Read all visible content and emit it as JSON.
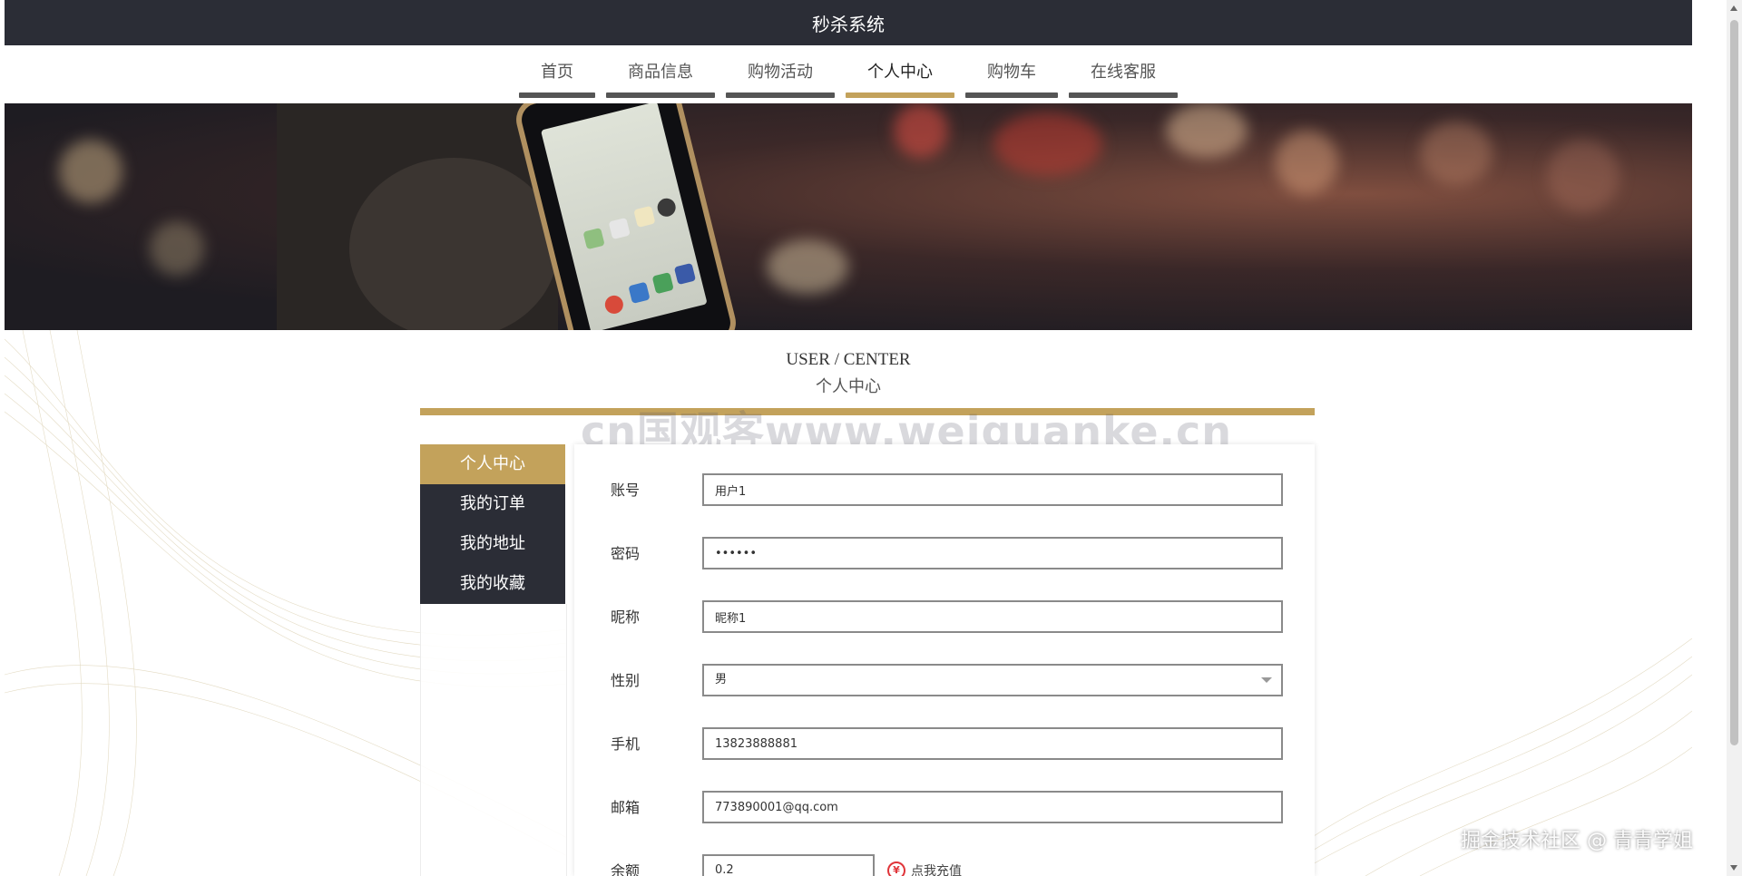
{
  "header": {
    "title": "秒杀系统"
  },
  "nav": {
    "items": [
      {
        "label": "首页"
      },
      {
        "label": "商品信息"
      },
      {
        "label": "购物活动"
      },
      {
        "label": "个人中心"
      },
      {
        "label": "购物车"
      },
      {
        "label": "在线客服"
      }
    ],
    "active_index": 3
  },
  "section": {
    "title_en": "USER / CENTER",
    "title_zh": "个人中心"
  },
  "watermark": "cn国观客www.weiguanke.cn",
  "side_menu": {
    "items": [
      {
        "label": "个人中心"
      },
      {
        "label": "我的订单"
      },
      {
        "label": "我的地址"
      },
      {
        "label": "我的收藏"
      }
    ],
    "active_index": 0
  },
  "form": {
    "account": {
      "label": "账号",
      "value": "用户1"
    },
    "password": {
      "label": "密码",
      "value": "••••••"
    },
    "nickname": {
      "label": "昵称",
      "value": "昵称1"
    },
    "gender": {
      "label": "性别",
      "value": "男"
    },
    "phone": {
      "label": "手机",
      "value": "13823888881"
    },
    "email": {
      "label": "邮箱",
      "value": "773890001@qq.com"
    },
    "balance": {
      "label": "余额",
      "value": "0.2",
      "recharge_label": "点我充值"
    }
  },
  "credit": "掘金技术社区 @ 青青学姐",
  "colors": {
    "dark": "#2b2d36",
    "gold": "#c3a25b"
  },
  "icons": {
    "recharge": "yuan-icon"
  }
}
